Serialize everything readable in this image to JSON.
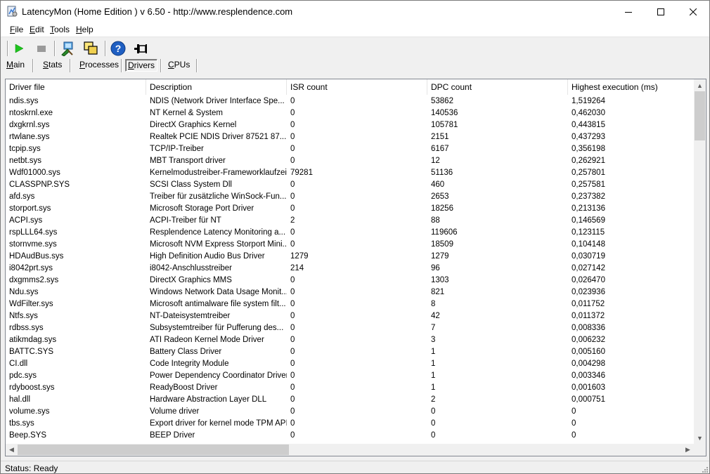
{
  "window": {
    "title": "LatencyMon  (Home Edition )  v 6.50 - http://www.resplendence.com"
  },
  "menu": {
    "items": [
      {
        "accel": "F",
        "rest": "ile"
      },
      {
        "accel": "E",
        "rest": "dit"
      },
      {
        "accel": "T",
        "rest": "ools"
      },
      {
        "accel": "H",
        "rest": "elp"
      }
    ]
  },
  "toolbar": {
    "icons": [
      "play-icon",
      "stop-icon",
      "system-info-icon",
      "windows-icon",
      "help-icon",
      "pin-icon"
    ]
  },
  "tabs": {
    "items": [
      {
        "accel": "M",
        "rest": "ain"
      },
      {
        "accel": "S",
        "rest": "tats"
      },
      {
        "accel": "P",
        "rest": "rocesses"
      },
      {
        "accel": "D",
        "rest": "rivers"
      },
      {
        "accel": "C",
        "rest": "PUs"
      }
    ],
    "active": "Drivers"
  },
  "table": {
    "columns": [
      "Driver file",
      "Description",
      "ISR count",
      "DPC count",
      "Highest execution (ms)"
    ],
    "rows": [
      [
        "ndis.sys",
        "NDIS (Network Driver Interface Spe...",
        "0",
        "53862",
        "1,519264"
      ],
      [
        "ntoskrnl.exe",
        "NT Kernel & System",
        "0",
        "140536",
        "0,462030"
      ],
      [
        "dxgkrnl.sys",
        "DirectX Graphics Kernel",
        "0",
        "105781",
        "0,443815"
      ],
      [
        "rtwlane.sys",
        "Realtek PCIE NDIS Driver 87521 87...",
        "0",
        "2151",
        "0,437293"
      ],
      [
        "tcpip.sys",
        "TCP/IP-Treiber",
        "0",
        "6167",
        "0,356198"
      ],
      [
        "netbt.sys",
        "MBT Transport driver",
        "0",
        "12",
        "0,262921"
      ],
      [
        "Wdf01000.sys",
        "Kernelmodustreiber-Frameworklaufzeit",
        "79281",
        "51136",
        "0,257801"
      ],
      [
        "CLASSPNP.SYS",
        "SCSI Class System Dll",
        "0",
        "460",
        "0,257581"
      ],
      [
        "afd.sys",
        "Treiber für zusätzliche WinSock-Fun...",
        "0",
        "2653",
        "0,237382"
      ],
      [
        "storport.sys",
        "Microsoft Storage Port Driver",
        "0",
        "18256",
        "0,213136"
      ],
      [
        "ACPI.sys",
        "ACPI-Treiber für NT",
        "2",
        "88",
        "0,146569"
      ],
      [
        "rspLLL64.sys",
        "Resplendence Latency Monitoring a...",
        "0",
        "119606",
        "0,123115"
      ],
      [
        "stornvme.sys",
        "Microsoft NVM Express Storport Mini...",
        "0",
        "18509",
        "0,104148"
      ],
      [
        "HDAudBus.sys",
        "High Definition Audio Bus Driver",
        "1279",
        "1279",
        "0,030719"
      ],
      [
        "i8042prt.sys",
        "i8042-Anschlusstreiber",
        "214",
        "96",
        "0,027142"
      ],
      [
        "dxgmms2.sys",
        "DirectX Graphics MMS",
        "0",
        "1303",
        "0,026470"
      ],
      [
        "Ndu.sys",
        "Windows Network Data Usage Monit...",
        "0",
        "821",
        "0,023936"
      ],
      [
        "WdFilter.sys",
        "Microsoft antimalware file system filt...",
        "0",
        "8",
        "0,011752"
      ],
      [
        "Ntfs.sys",
        "NT-Dateisystemtreiber",
        "0",
        "42",
        "0,011372"
      ],
      [
        "rdbss.sys",
        "Subsystemtreiber für Pufferung des...",
        "0",
        "7",
        "0,008336"
      ],
      [
        "atikmdag.sys",
        "ATI Radeon Kernel Mode Driver",
        "0",
        "3",
        "0,006232"
      ],
      [
        "BATTC.SYS",
        "Battery Class Driver",
        "0",
        "1",
        "0,005160"
      ],
      [
        "CI.dll",
        "Code Integrity Module",
        "0",
        "1",
        "0,004298"
      ],
      [
        "pdc.sys",
        "Power Dependency Coordinator Driver",
        "0",
        "1",
        "0,003346"
      ],
      [
        "rdyboost.sys",
        "ReadyBoost Driver",
        "0",
        "1",
        "0,001603"
      ],
      [
        "hal.dll",
        "Hardware Abstraction Layer DLL",
        "0",
        "2",
        "0,000751"
      ],
      [
        "volume.sys",
        "Volume driver",
        "0",
        "0",
        "0"
      ],
      [
        "tbs.sys",
        "Export driver for kernel mode TPM API",
        "0",
        "0",
        "0"
      ],
      [
        "Beep.SYS",
        "BEEP Driver",
        "0",
        "0",
        "0"
      ]
    ]
  },
  "status": {
    "text": "Status: Ready"
  }
}
